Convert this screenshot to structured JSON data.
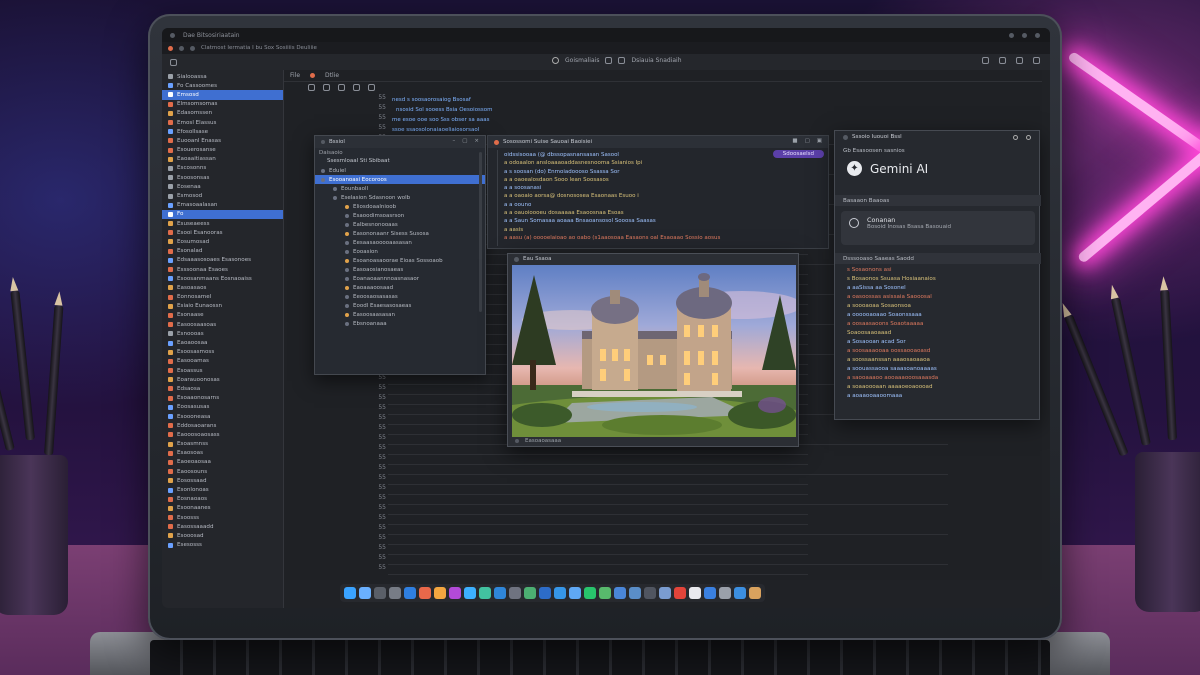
{
  "window": {
    "menu_title": "Dae Bitsosiriaatain",
    "menubar_text": "Clatmost Iermatia I bu Sox Sosiiiis Deuliiie",
    "center_title": "Goismaliais",
    "center_sub": "Dsiauia Snadiaih"
  },
  "editor": {
    "tab_label": "File",
    "tab2_label": "Dtlie",
    "line_numbers": [
      "55",
      "55",
      "55",
      "55",
      "55",
      "55",
      "55",
      "55",
      "55",
      "55",
      "55",
      "55",
      "55",
      "55",
      "55",
      "55",
      "55",
      "55",
      "55",
      "55",
      "55",
      "55",
      "55",
      "55",
      "55",
      "55",
      "55",
      "55",
      "55",
      "55",
      "55",
      "55",
      "55",
      "55",
      "55",
      "55",
      "55",
      "55",
      "55",
      "55",
      "55",
      "55",
      "55",
      "55",
      "55",
      "55",
      "55",
      "55"
    ]
  },
  "sidebar": {
    "items": [
      {
        "label": "Sialooassa",
        "color": "#9aa0a8"
      },
      {
        "label": "Fo Cassoomes",
        "color": "#6aa0ff"
      },
      {
        "label": "Emsosd",
        "color": "#ffffff",
        "selected": true
      },
      {
        "label": "Elmsomsomas",
        "color": "#e06c4a"
      },
      {
        "label": "Edasomssen",
        "color": "#e0a24a"
      },
      {
        "label": "Emosl Elassus",
        "color": "#e06c4a"
      },
      {
        "label": "Efosollsase",
        "color": "#6aa0ff"
      },
      {
        "label": "Euooanl Enasas",
        "color": "#e06c4a"
      },
      {
        "label": "Esouerosanse",
        "color": "#e06c4a"
      },
      {
        "label": "Eaoaaitiassan",
        "color": "#e0a24a"
      },
      {
        "label": "Escosonns",
        "color": "#9aa0a8"
      },
      {
        "label": "Esoosonsas",
        "color": "#9aa0a8"
      },
      {
        "label": "Eosenaa",
        "color": "#9aa0a8"
      },
      {
        "label": "Esmosod",
        "color": "#9aa0a8"
      },
      {
        "label": "Emasoaalasan",
        "color": "#6aa0ff"
      },
      {
        "label": "Fo",
        "color": "#ffffff",
        "selected": true
      },
      {
        "label": "Esuseaeess",
        "color": "#e0a24a"
      },
      {
        "label": "Esooi Esanooras",
        "color": "#e06c4a"
      },
      {
        "label": "Eosumosad",
        "color": "#e0a24a"
      },
      {
        "label": "Esonalad",
        "color": "#e06c4a"
      },
      {
        "label": "Edsaaasosoaes Esasonoes",
        "color": "#6aa0ff"
      },
      {
        "label": "Esssoonaa Esaoes",
        "color": "#e06c4a"
      },
      {
        "label": "Esoosanmaans Eosnaoaiss",
        "color": "#6aa0ff"
      },
      {
        "label": "Easoasaos",
        "color": "#e0a24a"
      },
      {
        "label": "Eonnosamel",
        "color": "#e06c4a"
      },
      {
        "label": "Esiaio Eunaossn",
        "color": "#e0a24a"
      },
      {
        "label": "Esonaase",
        "color": "#e06c4a"
      },
      {
        "label": "Easoosaasoas",
        "color": "#e06c4a"
      },
      {
        "label": "Esnoooas",
        "color": "#9aa0a8"
      },
      {
        "label": "Eaoaoosaa",
        "color": "#6aa0ff"
      },
      {
        "label": "Esoosasmoss",
        "color": "#e0a24a"
      },
      {
        "label": "Easooamas",
        "color": "#e06c4a"
      },
      {
        "label": "Esoassus",
        "color": "#e06c4a"
      },
      {
        "label": "Eoarauoonosas",
        "color": "#e0a24a"
      },
      {
        "label": "Edsaosa",
        "color": "#e06c4a"
      },
      {
        "label": "Esoaaonosarns",
        "color": "#e06c4a"
      },
      {
        "label": "Eoosasusas",
        "color": "#6aa0ff"
      },
      {
        "label": "Esoooneasa",
        "color": "#6aa0ff"
      },
      {
        "label": "Eddosaoarans",
        "color": "#e06c4a"
      },
      {
        "label": "Eaooosoaosass",
        "color": "#e06c4a"
      },
      {
        "label": "Esoasmnss",
        "color": "#e0a24a"
      },
      {
        "label": "Esaosoas",
        "color": "#e06c4a"
      },
      {
        "label": "Eaoeoaosaa",
        "color": "#e06c4a"
      },
      {
        "label": "Eaoosouns",
        "color": "#e06c4a"
      },
      {
        "label": "Eosossaad",
        "color": "#e0a24a"
      },
      {
        "label": "Esonlonoas",
        "color": "#6aa0ff"
      },
      {
        "label": "Eosnaoaos",
        "color": "#e06c4a"
      },
      {
        "label": "Esoonaanes",
        "color": "#e0a24a"
      },
      {
        "label": "Esoosss",
        "color": "#e06c4a"
      },
      {
        "label": "Easossaaadd",
        "color": "#e06c4a"
      },
      {
        "label": "Esooosad",
        "color": "#e0a24a"
      },
      {
        "label": "Esesosss",
        "color": "#6aa0ff"
      }
    ]
  },
  "filewin": {
    "title": "Bssiol",
    "path": "Daisaoio",
    "header": "Ssesmloaal Sti Sbibaat",
    "rows": [
      {
        "label": "Eduiel",
        "indent": 0
      },
      {
        "label": "Esooanoasi Eocoroos",
        "indent": 0,
        "selected": true
      },
      {
        "label": "Eounbaoll",
        "indent": 1
      },
      {
        "label": "Eselasion Sdasnoon wolb",
        "indent": 1
      },
      {
        "label": "Eliosdoaalnioob",
        "indent": 2
      },
      {
        "label": "Esaoodimsoasrson",
        "indent": 2
      },
      {
        "label": "Ealbesnonooaas",
        "indent": 2
      },
      {
        "label": "Easononaanr Sisess Susosa",
        "indent": 2
      },
      {
        "label": "Eesaasaooooaasasan",
        "indent": 2
      },
      {
        "label": "Eooasion",
        "indent": 2
      },
      {
        "label": "Esoanoasaoorae Eioas Sossoaob",
        "indent": 2
      },
      {
        "label": "Easoaosianosaeas",
        "indent": 2
      },
      {
        "label": "Eoanaoaannnoasnasaor",
        "indent": 2
      },
      {
        "label": "Eaoaaaoosaad",
        "indent": 2
      },
      {
        "label": "Eeoosaosasasas",
        "indent": 2
      },
      {
        "label": "Eoodl Esaesasosaeas",
        "indent": 2
      },
      {
        "label": "Easoosaasasan",
        "indent": 2
      },
      {
        "label": "Ebsnoanaaa",
        "indent": 2
      }
    ]
  },
  "codewin": {
    "title": "Sosossomi Suise Sauoai Baoisiei",
    "badge": "Sdoosaelsd",
    "lines": [
      "oidssisooaa (@ dbssopasnansasan Sasool",
      "a  odoaalon ansloaaaoaddasnesnooma Ssianios Ipi",
      "a  s soosan (do) Enmoiadoooso Ssassa Sor",
      "a  a  oaoealosdaon Sooo lean Soosasos",
      "a  a  soosanasi",
      "a  a  oaoaio aorsa@ dosnososea Esaonaas Esuoo i",
      "a  a  oouno",
      "a  a  oauoioooeu dosaaaaa Esaoosnaa Esoas",
      "a  a  Saun Somasaa aoaaa Bnsaoansosol Sooosa Saasas",
      "a  aasis",
      "a  aasu  (a)  ooooelaioao ao  oabo (s1aaosoaa Easaons oal Esaoaao Sossio  aosus"
    ]
  },
  "imgwin": {
    "title": "Eau Ssaoa",
    "footer": "Easoaoasaaa"
  },
  "gemini": {
    "title": "Sssoio Iuouoi Bssl",
    "subtitle": "Gb Esasoosen sasnios",
    "brand": "Gemini AI",
    "section1": "Basaaon Baaoas",
    "card_title": "Conanan",
    "card_sub": "Bosoid Inosas Bsasa Basouaid",
    "section2": "Dsssooaso Saaeas Saodd",
    "code": [
      "s  Sosaonons asi",
      "s  Bosaonos  Ssuasa Hosiaanaios",
      "a  aaSissa aa Sosonel",
      "a  oasoossas asissaia Saooosal",
      "a  soooaoaa Sosaonsoa",
      "a  oooooaoaao Soaonssaaa",
      "a  oosaasaoons Soaotaaaaa",
      "Soaoosaaoaaad",
      "a  Sosaooan acad Sor",
      "a  soosaaaooaa oossaooaoasd",
      "a  soossaanssan aaaosaoaaoa",
      "a  soouassaooa saaasoanoaaaas",
      "a  saooaaaoo aooaaaooosaaasda",
      "a  soaaoooaan aaaaoeoaoooad",
      "a  aoaaooaaoomaaa"
    ]
  },
  "dock": {
    "apps": [
      {
        "name": "finder-icon",
        "color": "#3aa3ff"
      },
      {
        "name": "mail-icon",
        "color": "#6ab0ff"
      },
      {
        "name": "terminal-icon",
        "color": "#5a5f68"
      },
      {
        "name": "settings-icon",
        "color": "#777c86"
      },
      {
        "name": "chrome-icon",
        "color": "#2f7fe0"
      },
      {
        "name": "calendar-icon",
        "color": "#e9684a"
      },
      {
        "name": "photos-icon",
        "color": "#f3a640"
      },
      {
        "name": "music-icon",
        "color": "#b24ad8"
      },
      {
        "name": "notes-icon",
        "color": "#3db0ff"
      },
      {
        "name": "maps-icon",
        "color": "#42c2a0"
      },
      {
        "name": "code-icon",
        "color": "#2f86d9"
      },
      {
        "name": "files-icon",
        "color": "#6f7380"
      },
      {
        "name": "slack-icon",
        "color": "#4caf72"
      },
      {
        "name": "drive-icon",
        "color": "#2d6cc8"
      },
      {
        "name": "xcode-icon",
        "color": "#3696e8"
      },
      {
        "name": "docs-icon",
        "color": "#5fa8f5"
      },
      {
        "name": "figma-icon",
        "color": "#28c46c"
      },
      {
        "name": "android-icon",
        "color": "#58b96c"
      },
      {
        "name": "studio-icon",
        "color": "#4a86d8"
      },
      {
        "name": "store-icon",
        "color": "#5a8ec8"
      },
      {
        "name": "tv-icon",
        "color": "#505560"
      },
      {
        "name": "gallery-icon",
        "color": "#7a9cd0"
      },
      {
        "name": "youtube-icon",
        "color": "#e2443a"
      },
      {
        "name": "chat-icon",
        "color": "#e9e9ee"
      },
      {
        "name": "keep-icon",
        "color": "#3a80e0"
      },
      {
        "name": "books-icon",
        "color": "#9aa0aa"
      },
      {
        "name": "cloud-icon",
        "color": "#3c8fe0"
      },
      {
        "name": "trash-icon",
        "color": "#d9a25e"
      }
    ]
  }
}
